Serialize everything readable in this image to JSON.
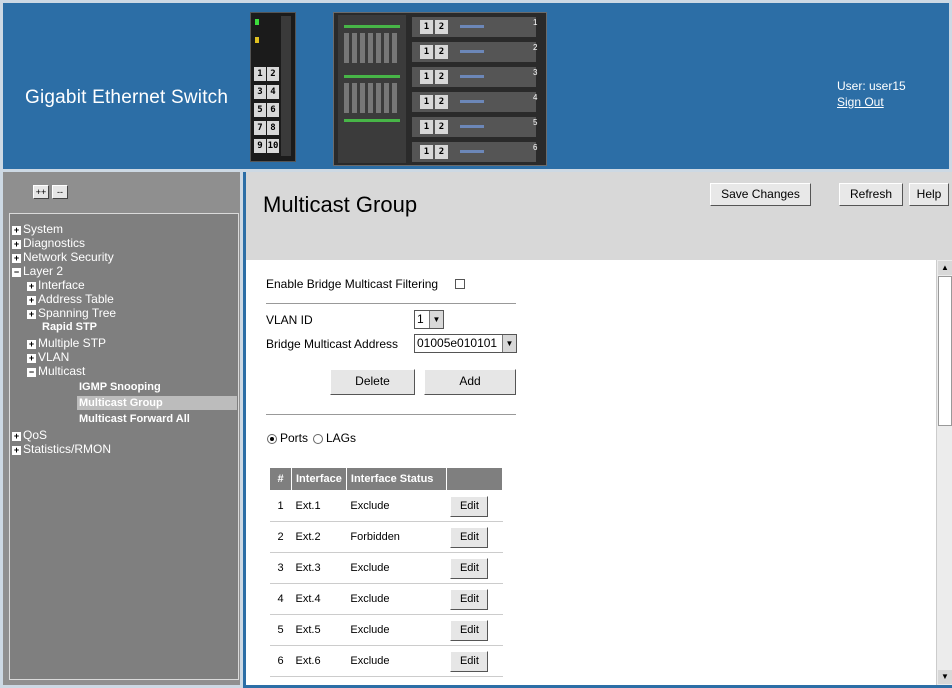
{
  "header": {
    "title": "Gigabit Ethernet Switch",
    "user_label": "User: user15",
    "sign_out": "Sign Out",
    "panel_port_labels": [
      "1",
      "2",
      "3",
      "4",
      "5",
      "6",
      "7",
      "8",
      "9",
      "10"
    ],
    "chassis_port_labels": [
      "1",
      "2"
    ],
    "slot_numbers": [
      "1",
      "2",
      "3",
      "4",
      "5",
      "6"
    ]
  },
  "sidebar": {
    "expand_all": "++",
    "collapse_all": "--",
    "items": [
      {
        "label": "System",
        "sign": "+"
      },
      {
        "label": "Diagnostics",
        "sign": "+"
      },
      {
        "label": "Network Security",
        "sign": "+"
      },
      {
        "label": "Layer 2",
        "sign": "−"
      },
      {
        "label": "Interface",
        "sign": "+"
      },
      {
        "label": "Address Table",
        "sign": "+"
      },
      {
        "label": "Spanning Tree",
        "sign": "+"
      },
      {
        "label": "Rapid STP",
        "sign": ""
      },
      {
        "label": "Multiple STP",
        "sign": "+"
      },
      {
        "label": "VLAN",
        "sign": "+"
      },
      {
        "label": "Multicast",
        "sign": "−"
      },
      {
        "label": "IGMP Snooping",
        "sign": ""
      },
      {
        "label": "Multicast Group",
        "sign": ""
      },
      {
        "label": "Multicast Forward All",
        "sign": ""
      },
      {
        "label": "QoS",
        "sign": "+"
      },
      {
        "label": "Statistics/RMON",
        "sign": "+"
      }
    ]
  },
  "main": {
    "title": "Multicast Group",
    "buttons": {
      "save": "Save Changes",
      "refresh": "Refresh",
      "help": "Help"
    },
    "form": {
      "enable_filtering_label": "Enable Bridge Multicast Filtering",
      "enable_filtering_checked": false,
      "vlan_id_label": "VLAN ID",
      "vlan_id_value": "1",
      "bridge_address_label": "Bridge Multicast Address",
      "bridge_address_value": "01005e010101",
      "delete_label": "Delete",
      "add_label": "Add",
      "ports_label": "Ports",
      "lags_label": "LAGs",
      "selected_view": "Ports"
    },
    "table": {
      "headers": [
        "#",
        "Interface",
        "Interface Status",
        ""
      ],
      "edit_label": "Edit",
      "rows": [
        {
          "num": "1",
          "interface": "Ext.1",
          "status": "Exclude"
        },
        {
          "num": "2",
          "interface": "Ext.2",
          "status": "Forbidden"
        },
        {
          "num": "3",
          "interface": "Ext.3",
          "status": "Exclude"
        },
        {
          "num": "4",
          "interface": "Ext.4",
          "status": "Exclude"
        },
        {
          "num": "5",
          "interface": "Ext.5",
          "status": "Exclude"
        },
        {
          "num": "6",
          "interface": "Ext.6",
          "status": "Exclude"
        }
      ]
    }
  },
  "colors": {
    "header_blue": "#2c6ea6",
    "sidebar_gray": "#7f7f7f"
  }
}
